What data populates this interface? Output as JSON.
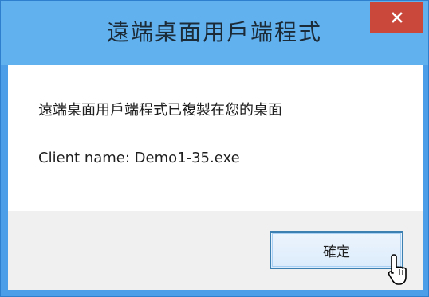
{
  "dialog": {
    "title": "遠端桌面用戶端程式",
    "close_glyph": "×",
    "message": "遠端桌面用戶端程式已複製在您的桌面",
    "client_line": "Client name: Demo1-35.exe",
    "ok_label": "確定"
  },
  "colors": {
    "titlebar": "#62b1ef",
    "frame": "#4c9ee8",
    "close_button": "#c9473b",
    "content_bg": "#ffffff",
    "footer_bg": "#f0f0f0",
    "button_border": "#3c7fb1"
  },
  "icons": {
    "close": "close-icon",
    "cursor": "mouse-pointer-icon"
  }
}
